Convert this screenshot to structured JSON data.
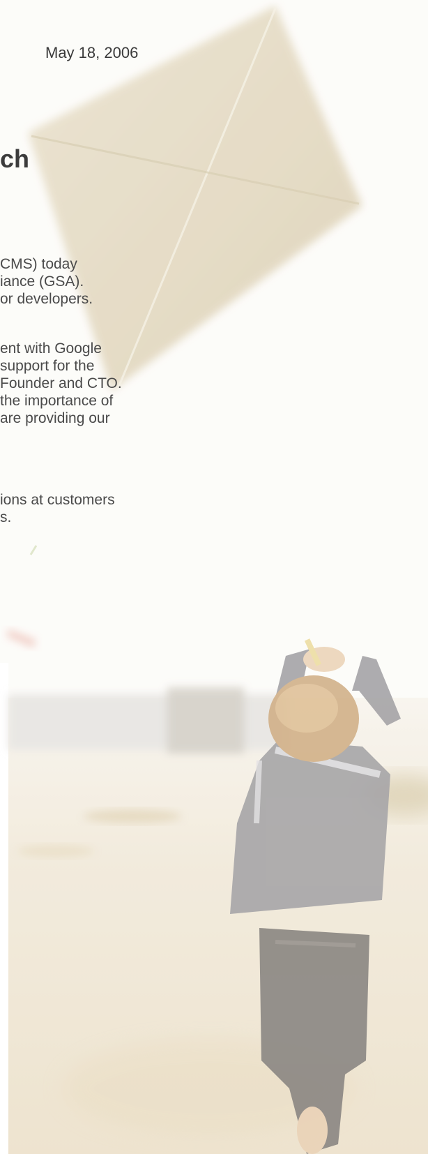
{
  "header": {
    "date": "May 18, 2006"
  },
  "article": {
    "title_fragment": "ch",
    "paragraphs": [
      [
        "CMS) today",
        "iance (GSA).",
        "or developers."
      ],
      [
        "ent with Google",
        "support for the",
        "Founder and CTO.",
        "the importance of",
        "are providing our"
      ],
      [
        "ions at customers",
        "s."
      ]
    ]
  },
  "illustration": {
    "kite_icon": "kite-icon",
    "child_icon": "running-child-icon",
    "colors": {
      "kite": "#dccfae",
      "sky": "#fbf9f5",
      "beach": "#ede0c6",
      "shirt": "#8f8d90",
      "jeans": "#6a6560",
      "hair": "#c59b68"
    }
  }
}
